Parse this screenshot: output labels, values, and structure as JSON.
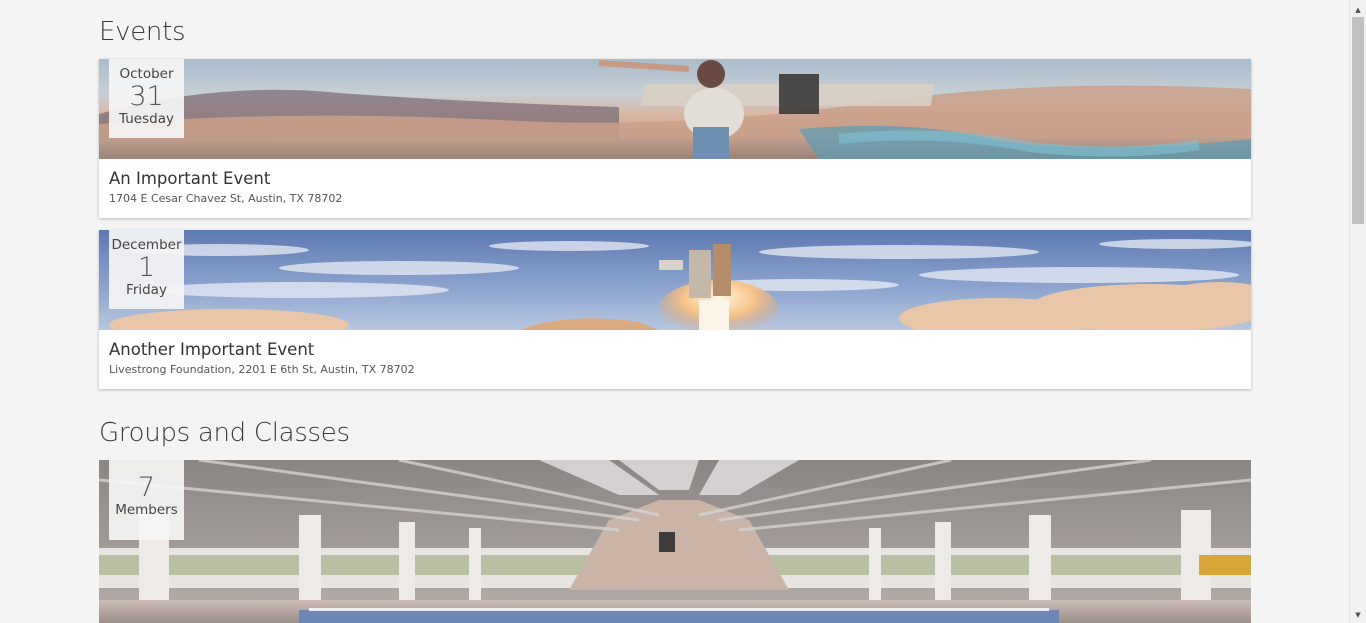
{
  "sections": {
    "events_title": "Events",
    "groups_title": "Groups and Classes"
  },
  "events": [
    {
      "month": "October",
      "day": "31",
      "weekday": "Tuesday",
      "title": "An Important Event",
      "address": "1704 E Cesar Chavez St, Austin, TX 78702",
      "image_icon": "jetpack-person-photo"
    },
    {
      "month": "December",
      "day": "1",
      "weekday": "Friday",
      "title": "Another Important Event",
      "address": "Livestrong Foundation, 2201 E 6th St, Austin, TX 78702",
      "image_icon": "rocket-launch-photo"
    }
  ],
  "groups": [
    {
      "count": "7",
      "label": "Members",
      "image_icon": "indoor-pool-photo"
    }
  ],
  "scrollbar": {
    "up_icon": "scroll-up-arrow-icon",
    "down_icon": "scroll-down-arrow-icon"
  },
  "colors": {
    "background": "#f4f4f4",
    "card": "#ffffff",
    "badge": "#f5f5f5",
    "text": "#333333"
  }
}
